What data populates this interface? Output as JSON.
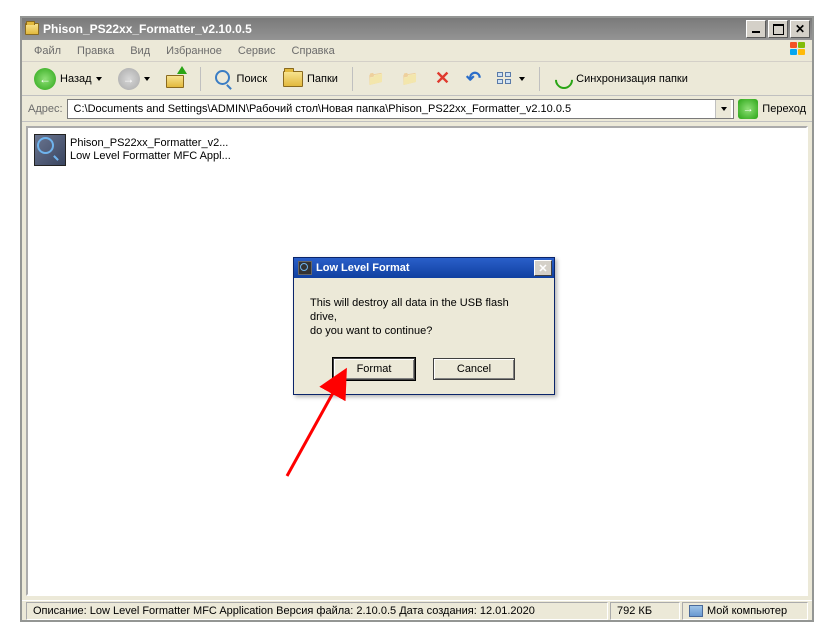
{
  "window": {
    "title": "Phison_PS22xx_Formatter_v2.10.0.5"
  },
  "menu": {
    "file": "Файл",
    "edit": "Правка",
    "view": "Вид",
    "favorites": "Избранное",
    "tools": "Сервис",
    "help": "Справка"
  },
  "toolbar": {
    "back": "Назад",
    "search": "Поиск",
    "folders": "Папки",
    "sync": "Синхронизация папки"
  },
  "address": {
    "label": "Адрес:",
    "path": "C:\\Documents and Settings\\ADMIN\\Рабочий стол\\Новая папка\\Phison_PS22xx_Formatter_v2.10.0.5",
    "go": "Переход"
  },
  "file_item": {
    "name": "Phison_PS22xx_Formatter_v2...",
    "desc": "Low Level Formatter MFC Appl..."
  },
  "dialog": {
    "title": "Low Level Format",
    "message_line1": "This will destroy all data in the USB flash drive,",
    "message_line2": "do you want to continue?",
    "format_btn": "Format",
    "cancel_btn": "Cancel"
  },
  "statusbar": {
    "desc": "Описание: Low Level Formatter MFC Application Версия файла: 2.10.0.5 Дата создания: 12.01.2020",
    "size": "792 КБ",
    "location": "Мой компьютер"
  }
}
